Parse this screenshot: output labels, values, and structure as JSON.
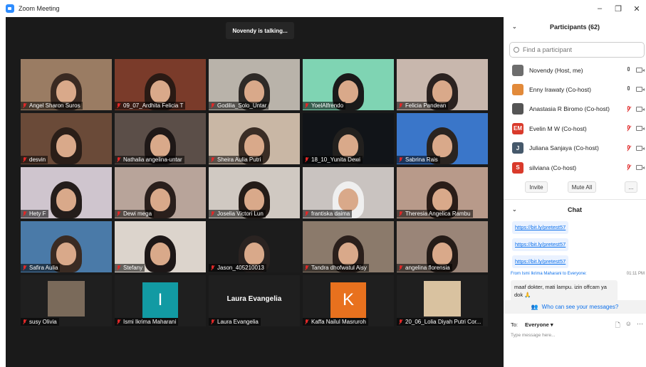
{
  "window": {
    "title": "Zoom Meeting",
    "minimize": "–",
    "restore": "❐",
    "close": "✕"
  },
  "video": {
    "talking_banner": "Novendy is talking...",
    "tiles": [
      {
        "name": "Angel Sharon Suros",
        "muted": true
      },
      {
        "name": "09_07_Ardhita Felicia T",
        "muted": true
      },
      {
        "name": "Godilia_Solo_Untar",
        "muted": true
      },
      {
        "name": "YoelAlfrendo",
        "muted": true
      },
      {
        "name": "Felicia Pandean",
        "muted": true
      },
      {
        "name": "desvin",
        "muted": true
      },
      {
        "name": "Nathalia angelina-untar",
        "muted": true
      },
      {
        "name": "Sheira Aulia Putri",
        "muted": true
      },
      {
        "name": "18_10_Yunita Dewi",
        "muted": true
      },
      {
        "name": "Sabrina Rais",
        "muted": true
      },
      {
        "name": "Hety F",
        "muted": true
      },
      {
        "name": "Dewi mega",
        "muted": true
      },
      {
        "name": "Joselia Victori Lun",
        "muted": true
      },
      {
        "name": "frantiska daima",
        "muted": true
      },
      {
        "name": "Theresia Angelica Rambu",
        "muted": true
      },
      {
        "name": "Safira Aulia",
        "muted": true
      },
      {
        "name": "Stefany",
        "muted": true
      },
      {
        "name": "Jason_405210013",
        "muted": true
      },
      {
        "name": "Tandra dhofwatul Aisy",
        "muted": true
      },
      {
        "name": "angelina florensia",
        "muted": true
      },
      {
        "name": "susy Olivia",
        "muted": true
      },
      {
        "name": "Ismi Ikrima Maharani",
        "muted": true,
        "avatar_letter": "I"
      },
      {
        "name": "Laura Evangelia",
        "muted": true,
        "center_name": "Laura Evangelia"
      },
      {
        "name": "Kaffa Nailul Masruroh",
        "muted": true,
        "avatar_letter": "K"
      },
      {
        "name": "20_06_Lolia Diyah Putri Cor...",
        "muted": true
      }
    ]
  },
  "participants": {
    "header": "Participants (62)",
    "search_placeholder": "Find a participant",
    "list": [
      {
        "name": "Novendy (Host, me)",
        "avatar": "",
        "avatar_color": "#6d6d6d",
        "muted": false
      },
      {
        "name": "Enny Irawaty (Co-host)",
        "avatar": "",
        "avatar_color": "#e28a3a",
        "muted": false
      },
      {
        "name": "Anastasia R Biromo (Co-host)",
        "avatar": "",
        "avatar_color": "#555555",
        "muted": true
      },
      {
        "name": "Evelin M W (Co-host)",
        "avatar": "EM",
        "avatar_color": "#d93a2b",
        "muted": true
      },
      {
        "name": "Juliana Sanjaya (Co-host)",
        "avatar": "J",
        "avatar_color": "#46596b",
        "muted": true
      },
      {
        "name": "silviana (Co-host)",
        "avatar": "S",
        "avatar_color": "#d93a2b",
        "muted": true
      }
    ],
    "invite_label": "Invite",
    "mute_all_label": "Mute All",
    "more_label": "..."
  },
  "chat": {
    "header": "Chat",
    "links": [
      "https://bit.ly/pretest57",
      "https://bit.ly/pretest57",
      "https://bit.ly/pretest57"
    ],
    "message_meta": "From Ismi Ikrima Maharani to Everyone:",
    "message_time": "01:11 PM",
    "message_text": "maaf dokter, mati lampu. izin offcam ya dok 🙏",
    "who_can_see": "Who can see your messages?",
    "to_label": "To:",
    "to_value": "Everyone ▾",
    "input_placeholder": "Type message here..."
  },
  "colors": {
    "accent": "#0e71eb",
    "muted_red": "#e02828",
    "stage_bg": "#1a1a1a"
  }
}
